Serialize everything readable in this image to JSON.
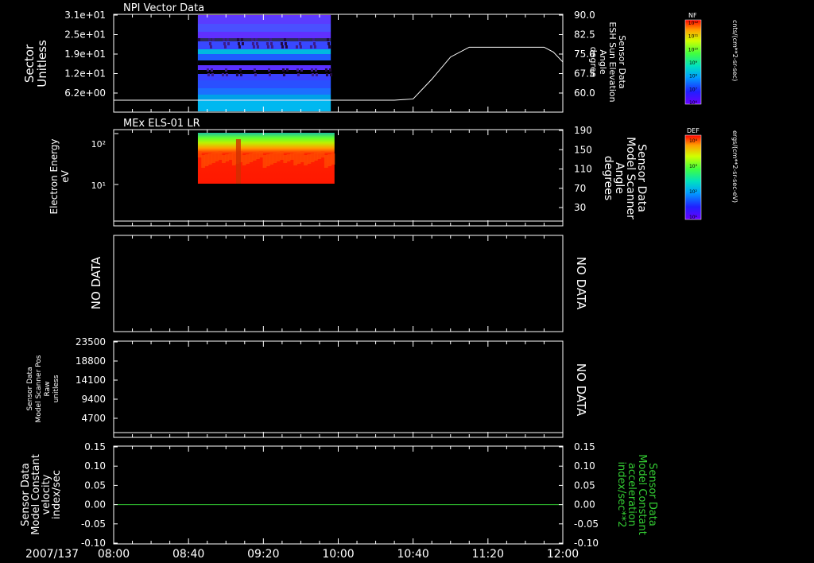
{
  "time_axis": {
    "date": "2007/137",
    "tick_labels": [
      "08:00",
      "08:40",
      "09:20",
      "10:00",
      "10:40",
      "11:20",
      "12:00"
    ]
  },
  "chart_data": [
    {
      "type": "heatmap",
      "id": "p1",
      "title": "NPI Vector Data",
      "ylabel_left": [
        "Sector",
        "Unitless"
      ],
      "yticks_left": [
        "3.1e+01",
        "2.5e+01",
        "1.9e+01",
        "1.2e+01",
        "6.2e+00"
      ],
      "ylabel_right": [
        "Sensor Data",
        "ESH Sun Elevation",
        "Angle",
        "degree"
      ],
      "yticks_right": [
        "90.0",
        "82.5",
        "75.0",
        "67.5",
        "60.0"
      ],
      "ylim_right": [
        55.5,
        90
      ],
      "data_time_range": [
        "08:45",
        "09:56"
      ],
      "line_series": {
        "name": "ESH Sun Elevation Angle",
        "x": [
          "08:00",
          "10:20",
          "10:30",
          "10:40",
          "10:50",
          "11:00",
          "11:10",
          "11:30",
          "11:40",
          "11:50",
          "11:55",
          "12:00"
        ],
        "y": [
          55.5,
          55.5,
          55.5,
          56,
          64,
          73,
          77,
          77,
          77,
          77,
          75,
          71
        ]
      },
      "colorbar": {
        "label": "NF",
        "tick_labels": [
          "10¹²",
          "10¹¹",
          "10¹⁰",
          "10⁹",
          "10⁸",
          "10⁷",
          "10⁶"
        ],
        "unit": "cnts/(cm**2-sr-sec)"
      }
    },
    {
      "type": "heatmap",
      "id": "p2",
      "title": "MEx ELS-01 LR",
      "ylabel_left": [
        "Electron Energy",
        "eV"
      ],
      "yticks_left": [
        "10²",
        "10¹"
      ],
      "ylabel_right": [
        "Sensor Data",
        "Model Scanner",
        "Angle",
        "degrees"
      ],
      "yticks_right": [
        "190",
        "150",
        "110",
        "70",
        "30"
      ],
      "ylim_right": [
        -10,
        190
      ],
      "data_time_range": [
        "08:45",
        "09:58"
      ],
      "line_series": {
        "name": "Model Scanner Angle",
        "x": [
          "08:00",
          "12:00"
        ],
        "y": [
          0,
          0
        ]
      },
      "colorbar": {
        "label": "DEF",
        "tick_labels": [
          "10⁴",
          "10³",
          "10²",
          "10¹"
        ],
        "unit": "ergs/(cm**2-sr-sec-eV)"
      }
    },
    {
      "type": "line",
      "id": "p3",
      "left_label": "NO DATA",
      "right_label": "NO DATA"
    },
    {
      "type": "line",
      "id": "p4",
      "ylabel_left": [
        "Sensor Data",
        "Model Scanner Pos",
        "Raw",
        "unitless"
      ],
      "yticks_left": [
        "23500",
        "18800",
        "14100",
        "9400",
        "4700"
      ],
      "ylim_left": [
        0,
        23500
      ],
      "right_label": "NO DATA",
      "line_series": {
        "name": "Model Scanner Pos",
        "x": [
          "08:00",
          "12:00"
        ],
        "y": [
          0,
          0
        ]
      }
    },
    {
      "type": "line",
      "id": "p5",
      "ylabel_left": [
        "Sensor Data",
        "Model Constant",
        "velocity",
        "index/sec"
      ],
      "yticks_left": [
        "0.15",
        "0.10",
        "0.05",
        "0.00",
        "-0.05",
        "-0.10"
      ],
      "ylabel_right": [
        "Sensor Data",
        "Model Constant",
        "acceleration",
        "index/sec**2"
      ],
      "yticks_right": [
        "0.15",
        "0.10",
        "0.05",
        "0.00",
        "-0.05",
        "-0.10"
      ],
      "ylim": [
        -0.1,
        0.15
      ],
      "line_color": "#33cc33",
      "line_series": {
        "name": "Model Constant acceleration",
        "x": [
          "08:00",
          "12:00"
        ],
        "y": [
          0,
          0
        ]
      }
    }
  ]
}
